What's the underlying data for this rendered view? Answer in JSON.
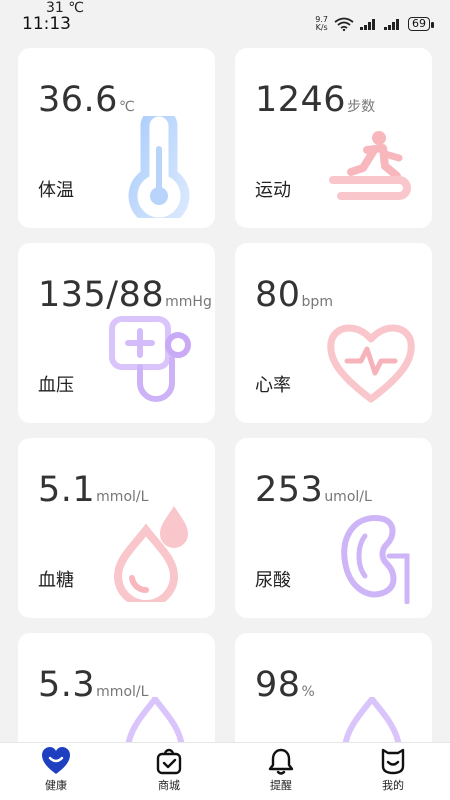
{
  "status_bar": {
    "temperature": "31 ℃",
    "time": "11:13",
    "net_speed_value": "9.7",
    "net_speed_unit": "K/s",
    "battery": "69"
  },
  "cards": [
    {
      "value": "36.6",
      "unit": "℃",
      "label": "体温",
      "icon": "thermometer-icon"
    },
    {
      "value": "1246",
      "unit": "步数",
      "label": "运动",
      "icon": "treadmill-icon"
    },
    {
      "value": "135/88",
      "unit": "mmHg",
      "label": "血压",
      "icon": "blood-pressure-icon"
    },
    {
      "value": "80",
      "unit": "bpm",
      "label": "心率",
      "icon": "heart-rate-icon"
    },
    {
      "value": "5.1",
      "unit": "mmol/L",
      "label": "血糖",
      "icon": "blood-drop-icon"
    },
    {
      "value": "253",
      "unit": "umol/L",
      "label": "尿酸",
      "icon": "kidney-icon"
    },
    {
      "value": "5.3",
      "unit": "mmol/L",
      "label": "",
      "icon": "drop-icon"
    },
    {
      "value": "98",
      "unit": "%",
      "label": "",
      "icon": "drop-icon"
    }
  ],
  "nav": [
    {
      "label": "健康",
      "icon": "heart-icon",
      "active": true
    },
    {
      "label": "商城",
      "icon": "shopping-bag-icon"
    },
    {
      "label": "提醒",
      "icon": "bell-icon"
    },
    {
      "label": "我的",
      "icon": "profile-icon"
    }
  ],
  "colors": {
    "accent": "#1e3fbf",
    "card_bg": "#ffffff",
    "page_bg": "#f2f2f2"
  }
}
